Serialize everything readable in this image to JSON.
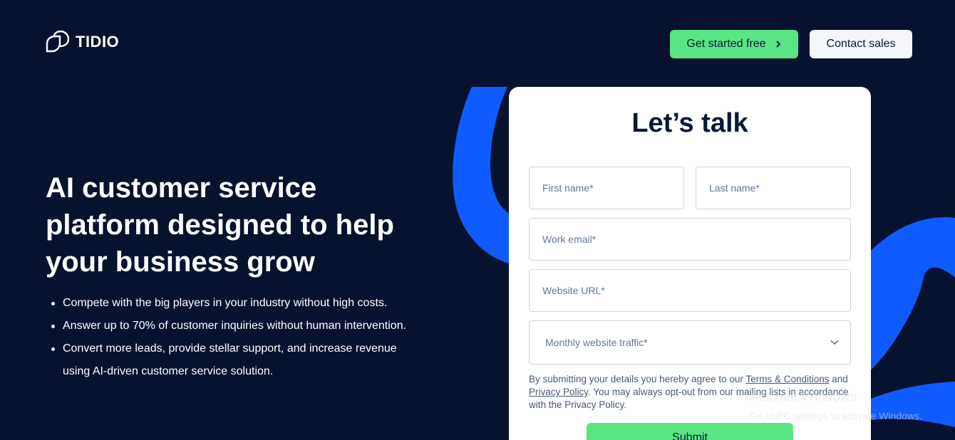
{
  "brand": {
    "name": "TIDIO"
  },
  "header": {
    "get_started_label": "Get started free",
    "contact_sales_label": "Contact sales"
  },
  "hero": {
    "title": "AI customer service platform designed to help your business grow",
    "bullets": [
      "Compete with the big players in your industry without high costs.",
      "Answer up to 70% of customer inquiries without human intervention.",
      "Convert more leads, provide stellar support, and increase revenue using AI-driven customer service solution."
    ]
  },
  "form": {
    "title": "Let’s talk",
    "first_name_placeholder": "First name*",
    "last_name_placeholder": "Last name*",
    "email_placeholder": "Work email*",
    "url_placeholder": "Website URL*",
    "traffic_placeholder": "Monthly website traffic*",
    "consent_prefix": "By submitting your details you hereby agree to our ",
    "terms_link": "Terms & Conditions",
    "consent_and": " and ",
    "privacy_link": "Privacy Policy",
    "consent_suffix": ". You may always opt-out from our mailing lists in accordance with the Privacy Policy.",
    "submit_label": "Submit"
  },
  "watermark": {
    "title": "Activate Windows",
    "subtitle": "Go to PC settings to activate Windows."
  },
  "colors": {
    "background": "#07122f",
    "accent_green": "#5ae585",
    "accent_blue": "#0e5cff"
  }
}
